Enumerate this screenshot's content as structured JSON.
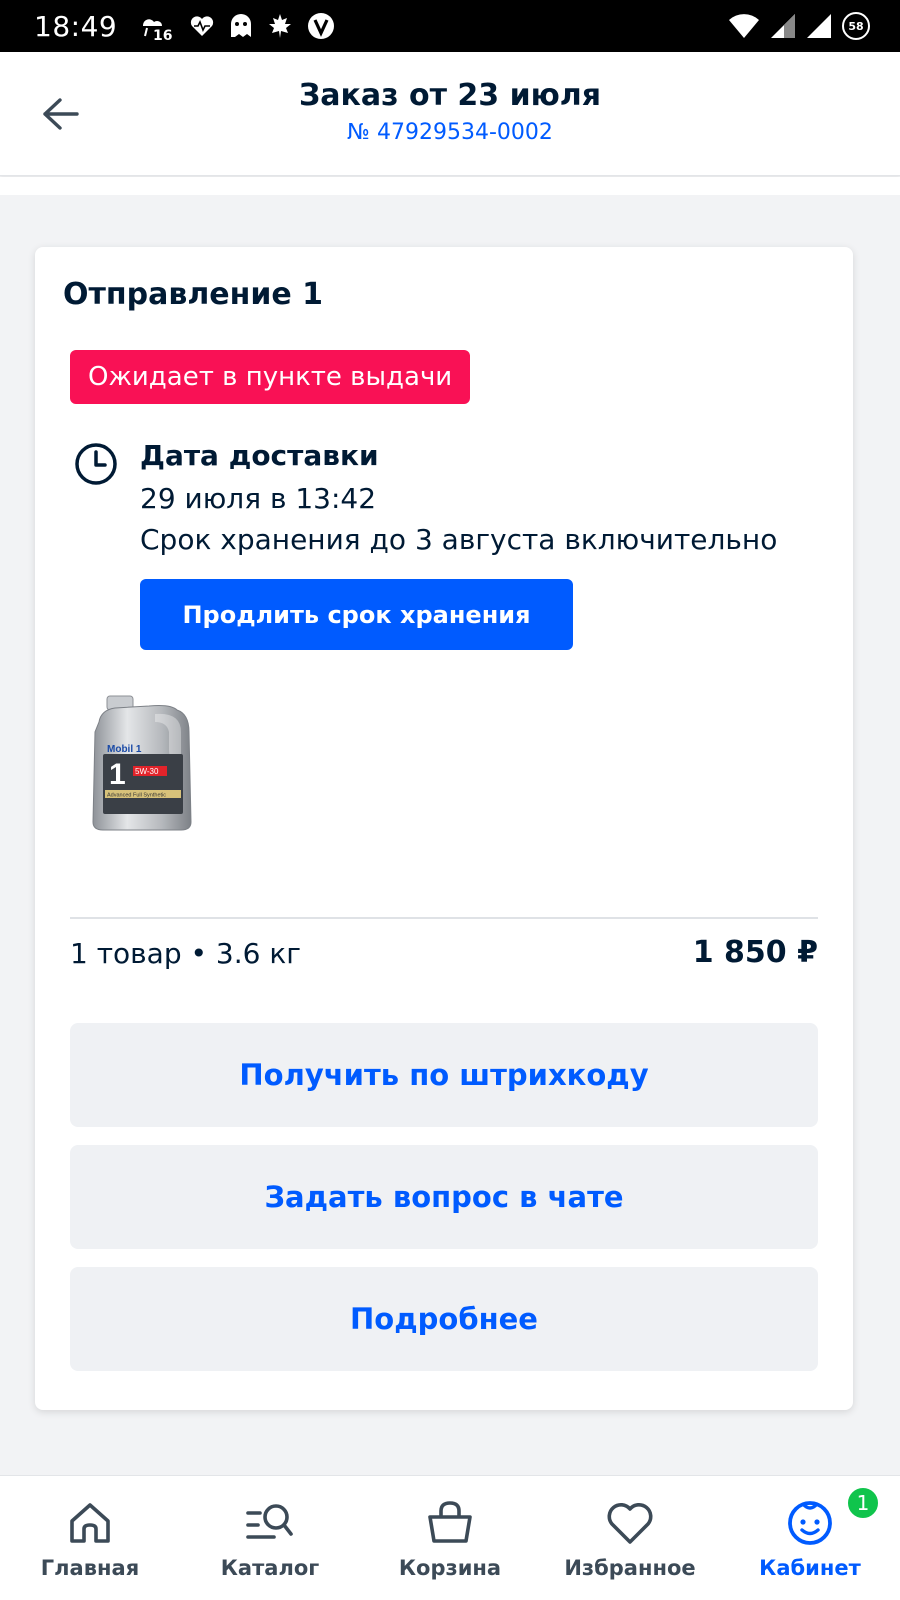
{
  "status_bar": {
    "time": "18:49",
    "battery_level": "58",
    "icons": [
      "weather-icon",
      "health-icon",
      "ghost-icon",
      "maple-leaf-icon",
      "v-app-icon",
      "wifi-icon",
      "signal-icon",
      "signal-icon",
      "battery-icon"
    ]
  },
  "header": {
    "title": "Заказ от 23 июля",
    "order_number": "№ 47929534-0002",
    "back_icon": "arrow-left-icon"
  },
  "shipment": {
    "title": "Отправление 1",
    "status": "Ожидает в пункте выдачи",
    "status_color": "#f91155",
    "delivery_label": "Дата доставки",
    "delivery_date": "29 июля в 13:42",
    "storage_text": "Срок хранения до 3 августа включительно",
    "extend_button": "Продлить срок хранения",
    "product": {
      "image_name": "mobil-1-oil-can",
      "brand_text": "Mobil 1",
      "viscosity": "5W-30",
      "subtitle": "Advanced Full Synthetic"
    },
    "summary": "1 товар • 3.6 кг",
    "price": "1 850 ₽"
  },
  "actions": {
    "barcode": "Получить по штрихкоду",
    "chat": "Задать вопрос в чате",
    "more": "Подробнее"
  },
  "bottom_nav": {
    "items": [
      {
        "label": "Главная",
        "icon": "home-icon"
      },
      {
        "label": "Каталог",
        "icon": "catalog-search-icon"
      },
      {
        "label": "Корзина",
        "icon": "basket-icon"
      },
      {
        "label": "Избранное",
        "icon": "heart-icon"
      },
      {
        "label": "Кабинет",
        "icon": "profile-smile-icon",
        "badge": "1"
      }
    ],
    "active_index": 4
  },
  "colors": {
    "accent": "#005bff",
    "text": "#001a34",
    "badge_green": "#10c44c"
  }
}
